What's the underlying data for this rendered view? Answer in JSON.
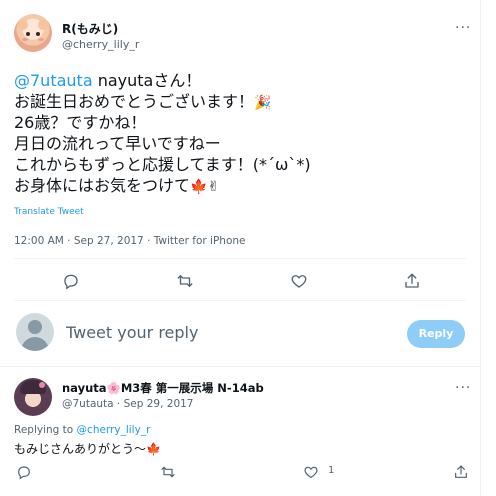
{
  "tweet": {
    "author_name": "R(もみじ)",
    "author_handle": "@cherry_lily_r",
    "more_label": "···",
    "mention": "@7utauta",
    "lines": [
      " nayutaさん！",
      "お誕生日おめでとうございます！",
      "26歳？ですかね！",
      "月日の流れって早いですねー",
      "これからもずっと応援してます！(*´ω`*)",
      "お身体にはお気をつけて"
    ],
    "emojis": {
      "party": "🎉",
      "maple": "🍁",
      "victory": "✌"
    },
    "translate_label": "Translate Tweet",
    "timestamp": "12:00 AM · Sep 27, 2017 · Twitter for iPhone"
  },
  "actions": {
    "icons": [
      "reply-icon",
      "retweet-icon",
      "like-icon",
      "share-icon"
    ]
  },
  "compose": {
    "placeholder": "Tweet your reply",
    "button_label": "Reply"
  },
  "reply_tweet": {
    "author_name": "nayuta🌸M3春 第一展示場 N-14ab",
    "author_handle_date": "@7utauta · Sep 29, 2017",
    "more_label": "···",
    "replying_to_prefix": "Replying to ",
    "replying_to_handle": "@cherry_lily_r",
    "text": "もみじさんありがとう〜🍁",
    "like_count": "1"
  },
  "colors": {
    "accent": "#1d9bf0",
    "muted_text": "#536471",
    "reply_button": "#8ecdf8",
    "divider": "#eff3f4"
  }
}
